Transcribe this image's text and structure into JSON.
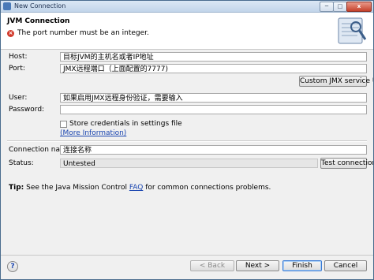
{
  "window": {
    "title": "New Connection",
    "controls": {
      "minimize": "─",
      "maximize": "□",
      "close": "x"
    }
  },
  "header": {
    "title": "JVM Connection",
    "error_message": "The port number must be an integer.",
    "error_icon": "error-icon"
  },
  "form": {
    "host_label": "Host:",
    "host_value": "目标JVM的主机名或者IP地址",
    "port_label": "Port:",
    "port_value": "JMX远程端口（上面配置的7777)",
    "custom_url_button": "Custom JMX service URL",
    "user_label": "User:",
    "user_value": "如果启用JMX远程身份验证，需要输入",
    "password_label": "Password:",
    "password_value": "",
    "store_credentials_label": "Store credentials in settings file",
    "store_credentials_checked": false,
    "more_info_link": "(More Information)",
    "connection_name_label": "Connection name:",
    "connection_name_value": "连接名称",
    "status_label": "Status:",
    "status_value": "Untested",
    "test_connection_button": "Test connection"
  },
  "tip": {
    "prefix": "Tip:",
    "text_before": " See the Java Mission Control ",
    "link": "FAQ",
    "text_after": " for common connections problems."
  },
  "buttons": {
    "help": "?",
    "back": "< Back",
    "next": "Next >",
    "finish": "Finish",
    "cancel": "Cancel"
  }
}
